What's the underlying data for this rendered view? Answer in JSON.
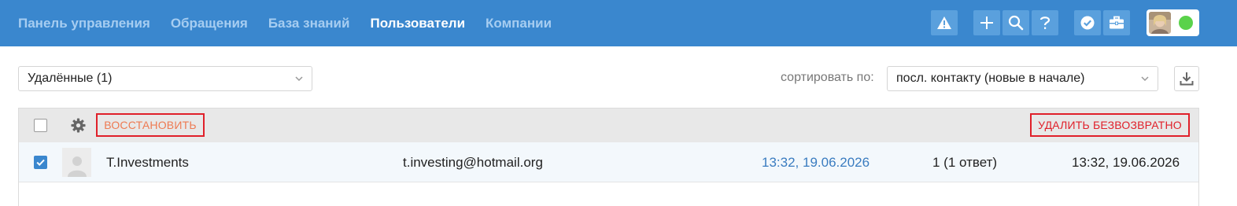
{
  "nav": {
    "items": [
      {
        "label": "Панель управления",
        "active": false
      },
      {
        "label": "Обращения",
        "active": false
      },
      {
        "label": "База знаний",
        "active": false
      },
      {
        "label": "Пользователи",
        "active": true
      },
      {
        "label": "Компании",
        "active": false
      }
    ]
  },
  "toolbar": {
    "icons": [
      "warning-icon",
      "plus-icon",
      "search-icon",
      "help-icon",
      "check-badge-icon",
      "briefcase-icon"
    ],
    "user_status_color": "#5ad24b"
  },
  "filter": {
    "selected": "Удалённые (1)"
  },
  "sort": {
    "label": "сортировать по:",
    "selected": "посл. контакту (новые в начале)"
  },
  "bulk_actions": {
    "restore_label": "ВОССТАНОВИТЬ",
    "delete_label": "УДАЛИТЬ БЕЗВОЗВРАТНО"
  },
  "users": [
    {
      "name": "T.Investments",
      "email": "t.investing@hotmail.org",
      "last_contact": "13:32, 19.06.2026",
      "tickets": "1 (1 ответ)",
      "created": "13:32, 19.06.2026",
      "checked": true
    }
  ],
  "colors": {
    "topbar": "#3a87ce",
    "accent_red": "#e0202a",
    "restore_text": "#ee7a52",
    "link": "#3a7cc0"
  }
}
